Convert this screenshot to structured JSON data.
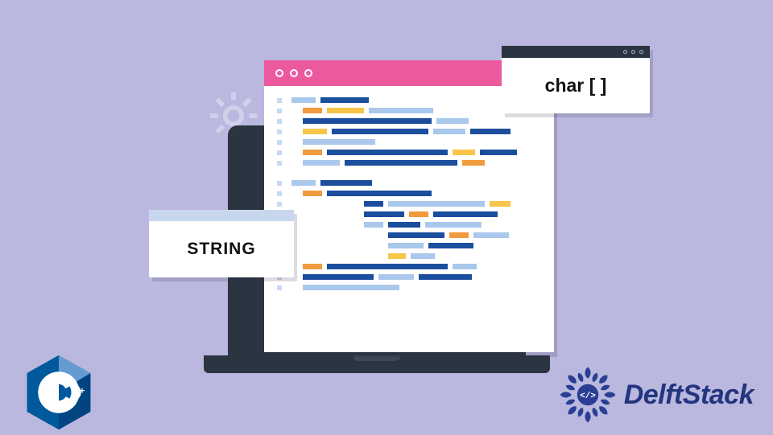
{
  "cards": {
    "string_label": "STRING",
    "char_label": "char [ ]"
  },
  "logos": {
    "cpp": "C++",
    "delftstack": "DelftStack"
  },
  "colors": {
    "background": "#bab8de",
    "titlebar": "#ec5a9d",
    "laptop": "#2b3542",
    "code_darkblue": "#1c4e9e",
    "code_lightblue": "#a9c8ec",
    "code_orange": "#f19a3e",
    "code_yellow": "#f7c548",
    "brand_blue": "#23357f"
  },
  "icons": {
    "gear": "gear-icon",
    "window_dots": "window-controls"
  }
}
